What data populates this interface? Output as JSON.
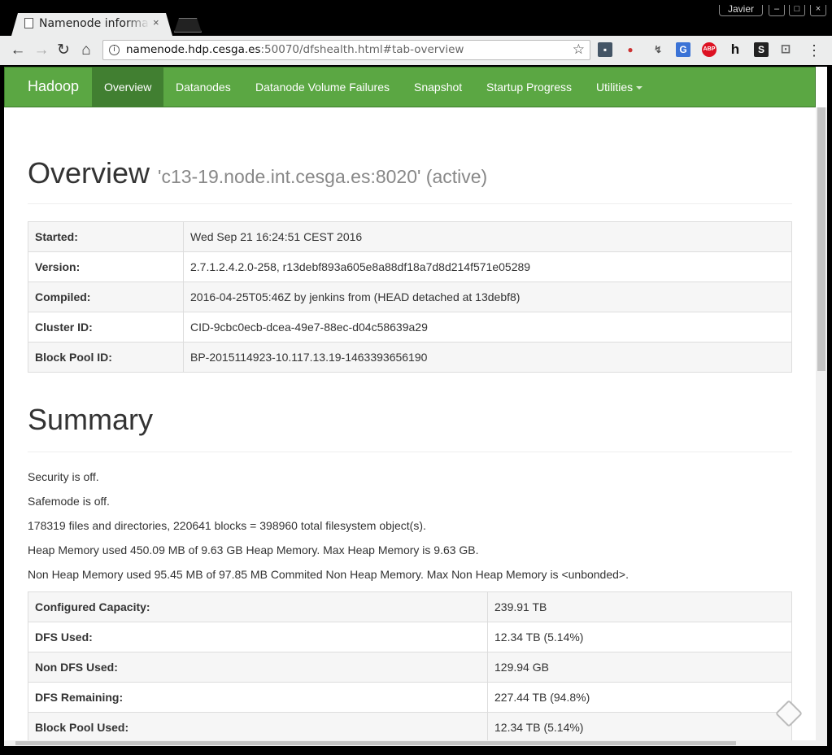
{
  "window": {
    "user": "Javier",
    "minimize": "–",
    "maximize": "□",
    "close": "×"
  },
  "tab": {
    "title": "Namenode information",
    "close": "×"
  },
  "toolbar": {
    "back": "←",
    "forward": "→",
    "reload": "↻",
    "home": "⌂",
    "info": "i",
    "url_host": "namenode.hdp.cesga.es",
    "url_rest": ":50070/dfshealth.html#tab-overview",
    "star": "☆",
    "menu": "⋮"
  },
  "extensions": [
    {
      "name": "ext-1",
      "glyph": "▪"
    },
    {
      "name": "ext-2",
      "glyph": "●"
    },
    {
      "name": "ext-3",
      "glyph": "↯"
    },
    {
      "name": "google-translate",
      "glyph": "G"
    },
    {
      "name": "adblock-plus",
      "glyph": "ABP"
    },
    {
      "name": "h-ext",
      "glyph": "h"
    },
    {
      "name": "s-ext",
      "glyph": "S"
    },
    {
      "name": "cast",
      "glyph": "⊡"
    }
  ],
  "navbar": {
    "brand": "Hadoop",
    "items": [
      "Overview",
      "Datanodes",
      "Datanode Volume Failures",
      "Snapshot",
      "Startup Progress",
      "Utilities"
    ]
  },
  "overview": {
    "title": "Overview",
    "subtitle": "'c13-19.node.int.cesga.es:8020' (active)",
    "rows": [
      {
        "key": "Started:",
        "value": "Wed Sep 21 16:24:51 CEST 2016"
      },
      {
        "key": "Version:",
        "value": "2.7.1.2.4.2.0-258, r13debf893a605e8a88df18a7d8d214f571e05289"
      },
      {
        "key": "Compiled:",
        "value": "2016-04-25T05:46Z by jenkins from (HEAD detached at 13debf8)"
      },
      {
        "key": "Cluster ID:",
        "value": "CID-9cbc0ecb-dcea-49e7-88ec-d04c58639a29"
      },
      {
        "key": "Block Pool ID:",
        "value": "BP-2015114923-10.117.13.19-1463393656190"
      }
    ]
  },
  "summary": {
    "title": "Summary",
    "lines": [
      "Security is off.",
      "Safemode is off.",
      "178319 files and directories, 220641 blocks = 398960 total filesystem object(s).",
      "Heap Memory used 450.09 MB of 9.63 GB Heap Memory. Max Heap Memory is 9.63 GB.",
      "Non Heap Memory used 95.45 MB of 97.85 MB Commited Non Heap Memory. Max Non Heap Memory is <unbonded>."
    ],
    "rows": [
      {
        "key": "Configured Capacity:",
        "value": "239.91 TB"
      },
      {
        "key": "DFS Used:",
        "value": "12.34 TB (5.14%)"
      },
      {
        "key": "Non DFS Used:",
        "value": "129.94 GB"
      },
      {
        "key": "DFS Remaining:",
        "value": "227.44 TB (94.8%)"
      },
      {
        "key": "Block Pool Used:",
        "value": "12.34 TB (5.14%)"
      }
    ]
  }
}
